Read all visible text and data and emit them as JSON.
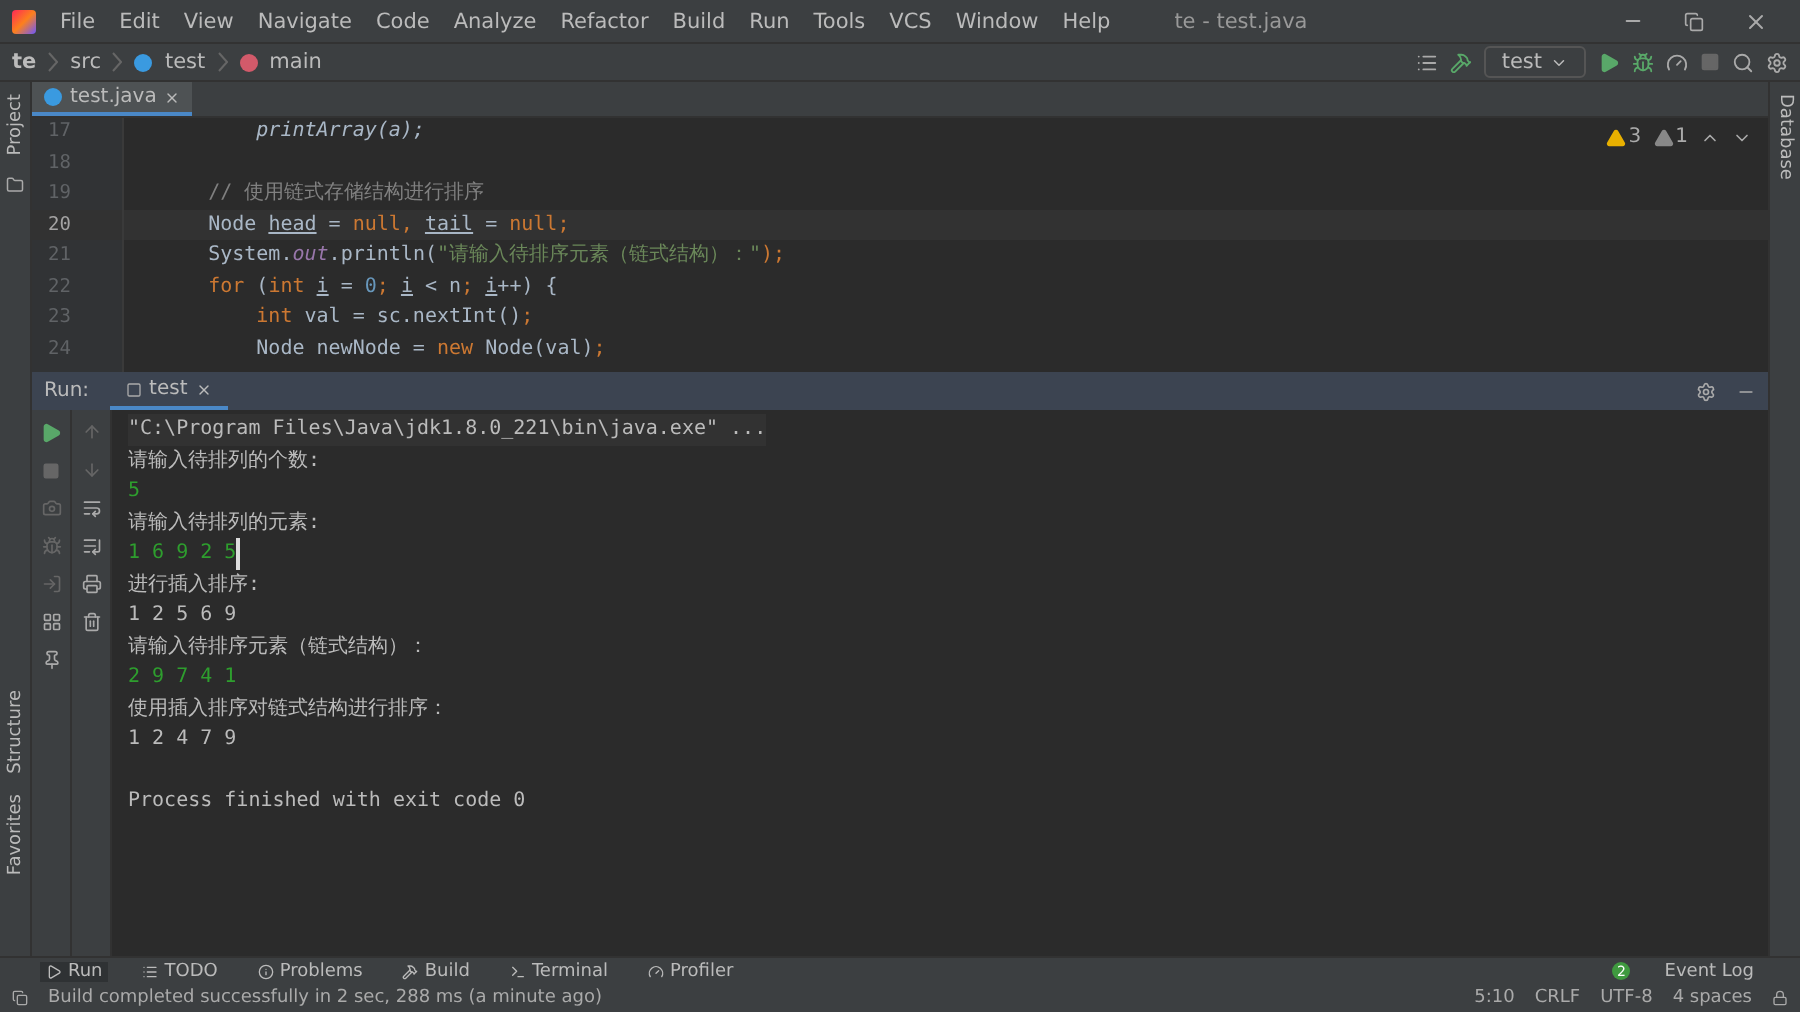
{
  "window": {
    "title": "te - test.java"
  },
  "menu": [
    "File",
    "Edit",
    "View",
    "Navigate",
    "Code",
    "Analyze",
    "Refactor",
    "Build",
    "Run",
    "Tools",
    "VCS",
    "Window",
    "Help"
  ],
  "breadcrumbs": [
    {
      "label": "te",
      "kind": "project"
    },
    {
      "label": "src",
      "kind": "folder"
    },
    {
      "label": "test",
      "kind": "class"
    },
    {
      "label": "main",
      "kind": "method"
    }
  ],
  "run_config": "test",
  "editor_tabs": [
    {
      "label": "test.java",
      "selected": true
    }
  ],
  "left_strip": [
    "Project",
    "Structure",
    "Favorites"
  ],
  "right_strip": [
    "Database"
  ],
  "inspections": [
    {
      "count": "3",
      "kind": "warning"
    },
    {
      "count": "1",
      "kind": "weak"
    }
  ],
  "code": [
    {
      "number": "17",
      "current": false,
      "tokens": [
        {
          "text": "        printArray(a);",
          "kind": "italic"
        }
      ]
    },
    {
      "number": "18",
      "current": false
    },
    {
      "number": "19",
      "current": false,
      "tokens": [
        {
          "text": "    // 使用链式存储结构进行排序",
          "kind": "comment"
        }
      ]
    },
    {
      "number": "20",
      "current": true,
      "tokens": [
        {
          "text": "    Node ",
          "kind": "plain"
        },
        {
          "text": "head",
          "kind": "underlined"
        },
        {
          "text": " = ",
          "kind": "plain"
        },
        {
          "text": "null, ",
          "kind": "keyword"
        },
        {
          "text": "tail",
          "kind": "underlined"
        },
        {
          "text": " = ",
          "kind": "plain"
        },
        {
          "text": "null;",
          "kind": "keyword"
        }
      ]
    },
    {
      "number": "21",
      "current": false,
      "tokens": [
        {
          "text": "    System.",
          "kind": "plain"
        },
        {
          "text": "out",
          "kind": "field"
        },
        {
          "text": ".println(",
          "kind": "plain"
        },
        {
          "text": "\"请输入待排序元素（链式结构）：\"",
          "kind": "string"
        },
        {
          "text": ");",
          "kind": "keyword"
        }
      ]
    },
    {
      "number": "22",
      "current": false,
      "tokens": [
        {
          "text": "    for ",
          "kind": "keyword"
        },
        {
          "text": "(",
          "kind": "plain"
        },
        {
          "text": "int ",
          "kind": "keyword"
        },
        {
          "text": "i",
          "kind": "underlined"
        },
        {
          "text": " = ",
          "kind": "plain"
        },
        {
          "text": "0",
          "kind": "number"
        },
        {
          "text": "; ",
          "kind": "keyword"
        },
        {
          "text": "i",
          "kind": "underlined"
        },
        {
          "text": " < n",
          "kind": "plain"
        },
        {
          "text": "; ",
          "kind": "keyword"
        },
        {
          "text": "i",
          "kind": "underlined"
        },
        {
          "text": "++) {",
          "kind": "plain"
        }
      ]
    },
    {
      "number": "23",
      "current": false,
      "tokens": [
        {
          "text": "        int ",
          "kind": "keyword"
        },
        {
          "text": "val = sc.nextInt()",
          "kind": "plain"
        },
        {
          "text": ";",
          "kind": "keyword"
        }
      ]
    },
    {
      "number": "24",
      "current": false,
      "tokens": [
        {
          "text": "        Node newNode = ",
          "kind": "plain"
        },
        {
          "text": "new ",
          "kind": "keyword"
        },
        {
          "text": "Node(val)",
          "kind": "plain"
        },
        {
          "text": ";",
          "kind": "keyword"
        }
      ]
    }
  ],
  "run_panel": {
    "label": "Run:",
    "tab": {
      "label": "test",
      "selected": true
    }
  },
  "console": [
    {
      "text": "\"C:\\Program Files\\Java\\jdk1.8.0_221\\bin\\java.exe\" ...",
      "kind": "command"
    },
    {
      "text": "请输入待排列的个数:",
      "kind": "output"
    },
    {
      "text": "5",
      "kind": "input"
    },
    {
      "text": "请输入待排列的元素:",
      "kind": "output"
    },
    {
      "text": "1 6 9 2 5",
      "kind": "input",
      "caret": true
    },
    {
      "text": "进行插入排序:",
      "kind": "output"
    },
    {
      "text": "1 2 5 6 9",
      "kind": "output"
    },
    {
      "text": "请输入待排序元素（链式结构）：",
      "kind": "output"
    },
    {
      "text": "2 9 7 4 1",
      "kind": "input"
    },
    {
      "text": "使用插入排序对链式结构进行排序：",
      "kind": "output"
    },
    {
      "text": "1 2 4 7 9",
      "kind": "output"
    },
    {
      "kind": "blank"
    },
    {
      "text": "Process finished with exit code 0",
      "kind": "output"
    }
  ],
  "tool_tabs": [
    {
      "label": "Run",
      "kind": "run",
      "selected": true
    },
    {
      "label": "TODO",
      "kind": "todo",
      "selected": false
    },
    {
      "label": "Problems",
      "kind": "problems",
      "selected": false
    },
    {
      "label": "Build",
      "kind": "build",
      "selected": false
    },
    {
      "label": "Terminal",
      "kind": "terminal",
      "selected": false
    },
    {
      "label": "Profiler",
      "kind": "profiler",
      "selected": false
    }
  ],
  "event_log": {
    "label": "Event Log",
    "count": "2"
  },
  "status_bar": {
    "message": "Build completed successfully in 2 sec, 288 ms (a minute ago)",
    "position": "5:10",
    "line_ending": "CRLF",
    "encoding": "UTF-8",
    "indent": "4 spaces"
  }
}
